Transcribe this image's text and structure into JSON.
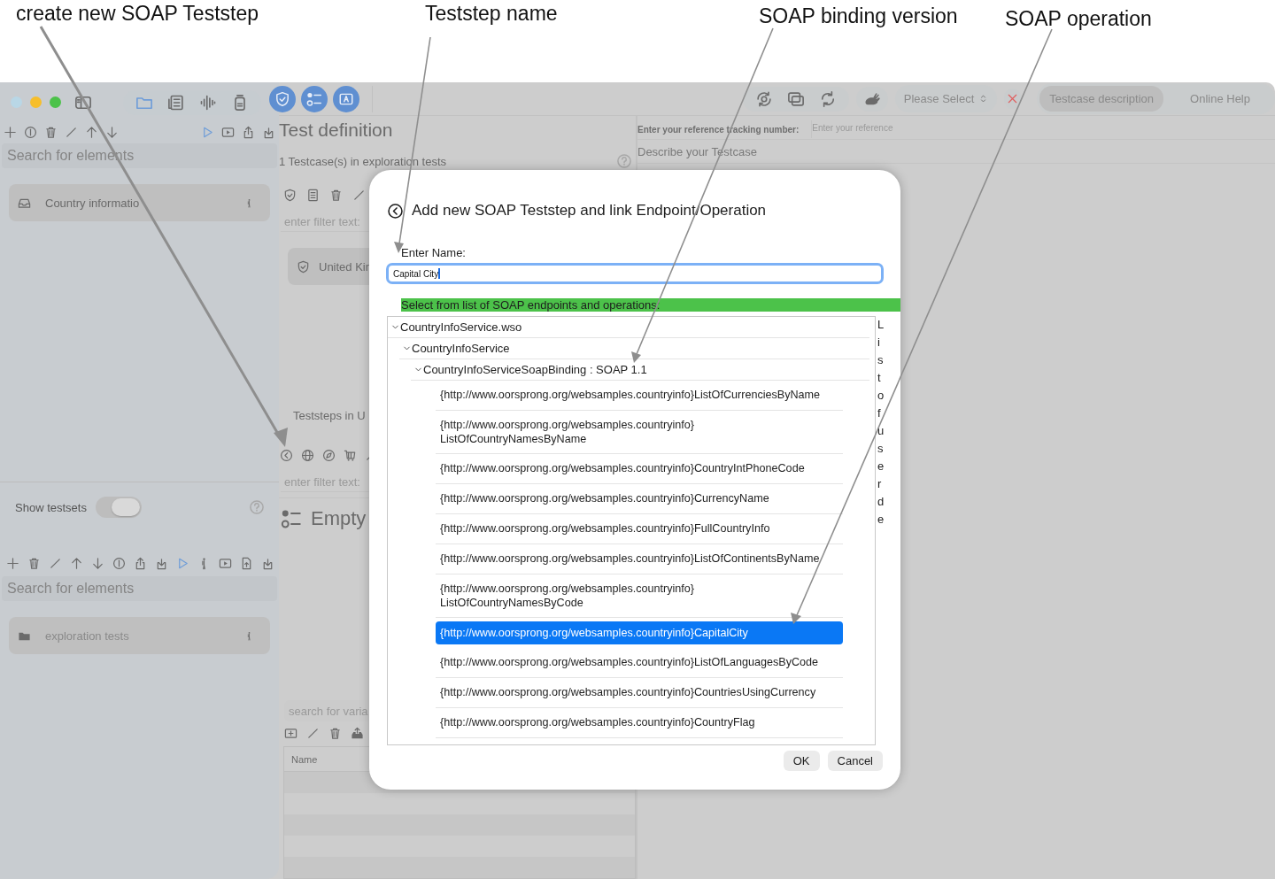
{
  "annotations": [
    {
      "text": "create new SOAP Teststep"
    },
    {
      "text": "Teststep name"
    },
    {
      "text": "SOAP binding version"
    },
    {
      "text": "SOAP operation"
    }
  ],
  "toolbar": {
    "scheme_select": "Please Select",
    "description_button": "Testcase description",
    "help_button": "Online Help"
  },
  "sidebar": {
    "search_placeholder": "Search for elements",
    "testcases": [
      {
        "label": "Country informatio"
      }
    ],
    "show_testsets": {
      "label": "Show testsets",
      "on": true
    },
    "testset_search_placeholder": "Search for elements",
    "testsets": [
      {
        "label": "exploration tests"
      }
    ]
  },
  "definition": {
    "title": "Test definition",
    "subtitle": "1 Testcase(s) in exploration tests",
    "filter_placeholder": "enter filter text:",
    "testcases": [
      {
        "label": "United Kin"
      }
    ],
    "teststeps_heading": "Teststeps in U",
    "step_filter_placeholder": "enter filter text:",
    "empty_label": "Empty",
    "variable_search_placeholder": "search for varia",
    "variable_table": {
      "columns": [
        "Name"
      ]
    }
  },
  "details": {
    "reference_label": "Enter your reference tracking number:",
    "reference_placeholder": "Enter your reference",
    "description_placeholder": "Describe your Testcase"
  },
  "dialog": {
    "title": "Add new SOAP Teststep and link Endpoint/Operation",
    "name_label": "Enter Name:",
    "name_value": "Capital City",
    "list_label": "Select from list of SOAP endpoints and operations:",
    "tree": [
      {
        "label": "CountryInfoService.wso",
        "expanded": true,
        "children": [
          {
            "label": "CountryInfoService",
            "expanded": true,
            "children": [
              {
                "label": "CountryInfoServiceSoapBinding : SOAP 1.1",
                "expanded": true,
                "children": [
                  {
                    "label": "{http://www.oorsprong.org/websamples.countryinfo}ListOfCurrenciesByName",
                    "selected": false
                  },
                  {
                    "label": "{http://www.oorsprong.org/websamples.countryinfo} ListOfCountryNamesByName",
                    "selected": false
                  },
                  {
                    "label": "{http://www.oorsprong.org/websamples.countryinfo}CountryIntPhoneCode",
                    "selected": false
                  },
                  {
                    "label": "{http://www.oorsprong.org/websamples.countryinfo}CurrencyName",
                    "selected": false
                  },
                  {
                    "label": "{http://www.oorsprong.org/websamples.countryinfo}FullCountryInfo",
                    "selected": false
                  },
                  {
                    "label": "{http://www.oorsprong.org/websamples.countryinfo}ListOfContinentsByName",
                    "selected": false
                  },
                  {
                    "label": "{http://www.oorsprong.org/websamples.countryinfo} ListOfCountryNamesByCode",
                    "selected": false
                  },
                  {
                    "label": "{http://www.oorsprong.org/websamples.countryinfo}CapitalCity",
                    "selected": true
                  },
                  {
                    "label": "{http://www.oorsprong.org/websamples.countryinfo}ListOfLanguagesByCode",
                    "selected": false
                  },
                  {
                    "label": "{http://www.oorsprong.org/websamples.countryinfo}CountriesUsingCurrency",
                    "selected": false
                  },
                  {
                    "label": "{http://www.oorsprong.org/websamples.countryinfo}CountryFlag",
                    "selected": false
                  }
                ]
              }
            ]
          }
        ]
      }
    ],
    "side_label": "Listofuserde",
    "buttons": [
      {
        "label": "OK"
      },
      {
        "label": "Cancel"
      }
    ]
  }
}
